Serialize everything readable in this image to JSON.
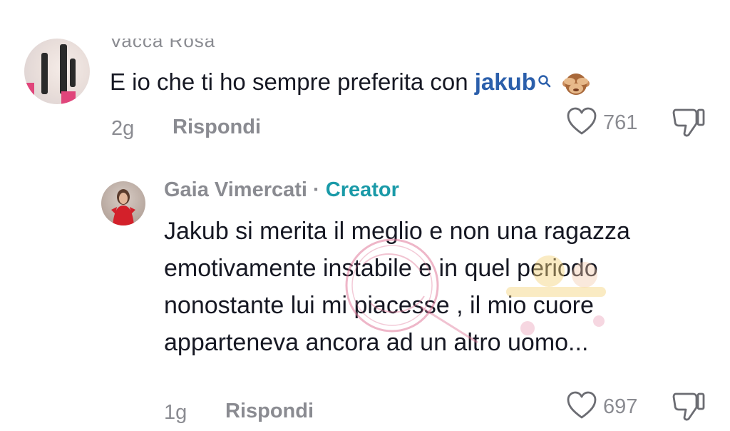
{
  "comments": [
    {
      "username": "Vacca Rosa",
      "text_before": "E io che ti ho sempre preferita con ",
      "mention": "jakub",
      "time": "2g",
      "reply_label": "Rispondi",
      "likes": "761",
      "icons": {
        "mention_search": "search-icon",
        "emoji": "see-no-evil-monkey-icon",
        "like": "heart-icon",
        "dislike": "thumbs-down-icon"
      }
    }
  ],
  "reply": {
    "username": "Gaia Vimercati",
    "separator": " · ",
    "badge": "Creator",
    "text": "Jakub si merita il meglio e non una ragazza emotivamente instabile e in quel periodo nonostante lui mi piacesse , il mio cuore apparteneva ancora ad un altro uomo...",
    "time": "1g",
    "reply_label": "Rispondi",
    "likes": "697",
    "icons": {
      "like": "heart-icon",
      "dislike": "thumbs-down-icon"
    }
  },
  "colors": {
    "text": "#161823",
    "muted": "#8a8b91",
    "mention": "#2b5fab",
    "creator_badge": "#1a9aa8",
    "watermark_pink": "#e07a9a"
  }
}
